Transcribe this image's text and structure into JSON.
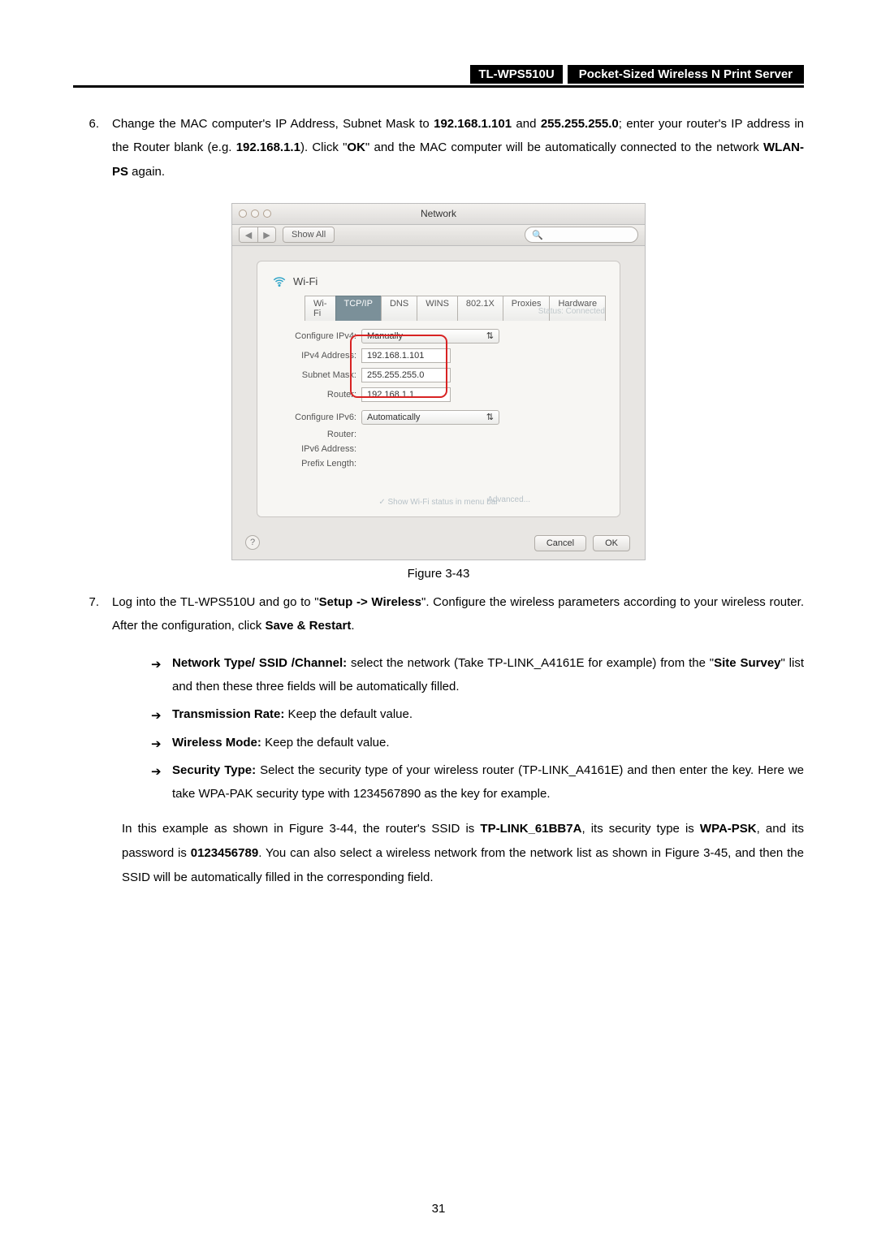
{
  "header": {
    "model": "TL-WPS510U",
    "title": "Pocket-Sized Wireless N Print Server"
  },
  "step6": {
    "num": "6.",
    "parts": {
      "t1": "Change the MAC computer's IP Address, Subnet Mask to ",
      "b1": "192.168.1.101",
      "t2": " and ",
      "b2": "255.255.255.0",
      "t3": "; enter your router's IP address in the Router blank (e.g. ",
      "b3": "192.168.1.1",
      "t4": "). Click \"",
      "b4": "OK",
      "t5": "\" and the MAC computer will be automatically connected to the network ",
      "b5": "WLAN-PS",
      "t6": " again."
    }
  },
  "macWindow": {
    "title": "Network",
    "showAll": "Show All",
    "searchPlaceholder": "",
    "wifiLabel": "Wi-Fi",
    "tabs": [
      "Wi-Fi",
      "TCP/IP",
      "DNS",
      "WINS",
      "802.1X",
      "Proxies",
      "Hardware"
    ],
    "activeTab": "TCP/IP",
    "fields": {
      "configureIPv4": {
        "label": "Configure IPv4:",
        "value": "Manually"
      },
      "ipv4Address": {
        "label": "IPv4 Address:",
        "value": "192.168.1.101"
      },
      "subnetMask": {
        "label": "Subnet Mask:",
        "value": "255.255.255.0"
      },
      "router": {
        "label": "Router:",
        "value": "192.168.1.1"
      },
      "configureIPv6": {
        "label": "Configure IPv6:",
        "value": "Automatically"
      },
      "router2": {
        "label": "Router:",
        "value": ""
      },
      "ipv6Address": {
        "label": "IPv6 Address:",
        "value": ""
      },
      "prefixLength": {
        "label": "Prefix Length:",
        "value": ""
      }
    },
    "ghostStatus": "Status:   Connected",
    "ghostCheckbox": "Show Wi-Fi status in menu bar",
    "advanced": "Advanced...",
    "cancel": "Cancel",
    "ok": "OK",
    "help": "?"
  },
  "figureCaption": "Figure 3-43",
  "step7": {
    "num": "7.",
    "parts": {
      "t1": "Log into the TL-WPS510U and go to \"",
      "b1": "Setup -> Wireless",
      "t2": "\". Configure the wireless parameters according to your wireless router. After the configuration, click ",
      "b2": "Save & Restart",
      "t3": "."
    }
  },
  "bullets": [
    {
      "lead": "Network Type/ SSID /Channel:",
      "rest1": " select the network (Take TP-LINK_A4161E for example) from the \"",
      "bold": "Site Survey",
      "rest2": "\" list and then these three fields will be automatically filled."
    },
    {
      "lead": "Transmission Rate:",
      "rest1": " Keep the default value.",
      "bold": "",
      "rest2": ""
    },
    {
      "lead": "Wireless Mode:",
      "rest1": " Keep the default value.",
      "bold": "",
      "rest2": ""
    },
    {
      "lead": "Security Type:",
      "rest1": " Select the security type of your wireless router (TP-LINK_A4161E) and then enter the key. Here we take WPA-PAK security type with 1234567890 as the key for example.",
      "bold": "",
      "rest2": ""
    }
  ],
  "exampleParagraph": {
    "t1": "In this example as shown in Figure 3-44, the router's SSID is ",
    "b1": "TP-LINK_61BB7A",
    "t2": ", its security type is ",
    "b2": "WPA-PSK",
    "t3": ", and its password is ",
    "b3": "0123456789",
    "t4": ". You can also select a wireless network from the network list as shown in Figure 3-45, and then the SSID will be automatically filled in the corresponding field."
  },
  "pageNumber": "31"
}
